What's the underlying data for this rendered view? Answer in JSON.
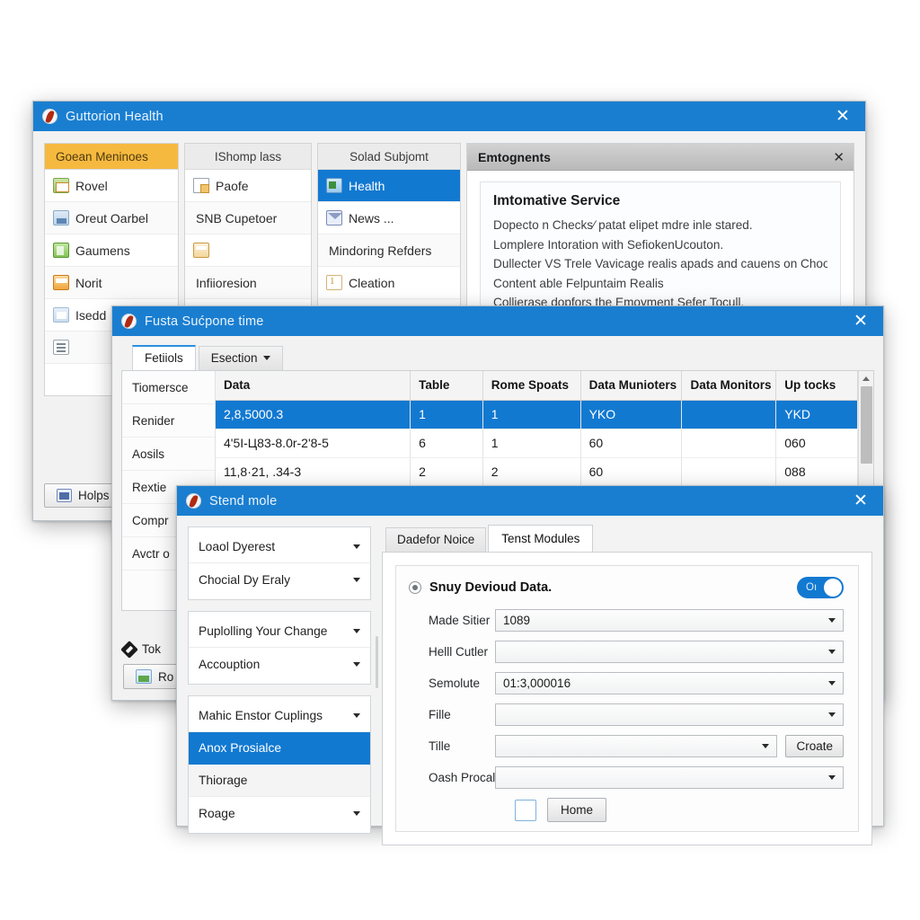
{
  "window1": {
    "title": "Guttorion Health",
    "close_label": "✕",
    "columns": [
      {
        "header": "Goean Meninoes",
        "items": [
          {
            "label": "Rovel",
            "icon": "document-green-icon"
          },
          {
            "label": "Oreut Oarbel",
            "icon": "chart-blue-icon"
          },
          {
            "label": "Gaumens",
            "icon": "app-green-icon"
          },
          {
            "label": "Norit",
            "icon": "card-orange-icon"
          },
          {
            "label": "Isedd",
            "icon": "pale-blue-icon"
          },
          {
            "label": "",
            "icon": "document-icon"
          }
        ]
      },
      {
        "header": "IShomp lass",
        "items": [
          {
            "label": "Paofe",
            "icon": "page-icon"
          },
          {
            "label": "SNB Cupetoer",
            "icon": ""
          },
          {
            "label": "",
            "icon": "card-icon"
          },
          {
            "label": "Infiioresion",
            "icon": ""
          },
          {
            "label": "",
            "icon": ""
          }
        ]
      },
      {
        "header": "Solad Subjomt",
        "items": [
          {
            "label": "Health",
            "icon": "health-icon",
            "selected": true
          },
          {
            "label": "News ...",
            "icon": "mail-icon"
          },
          {
            "label": "Mindoring Refders",
            "icon": ""
          },
          {
            "label": "Cleation",
            "icon": "number-icon"
          },
          {
            "label": "",
            "icon": "mail2-icon"
          }
        ]
      }
    ],
    "detail": {
      "title": "Emtognents",
      "close_label": "✕",
      "heading": "Imtomative Service",
      "lines": [
        "Dopecto n Checks⁄ patat elipet mdre inle stared.",
        "Lomplere Intoration with SefiokenUcouton.",
        "Dullecter VS Trele Vavicage realis apads and cauens on Choolt.",
        "Content able Felpuntaim Realis",
        "Collierase dopfors the Emoyment Sefer Tocull."
      ]
    },
    "footer": {
      "help_label": "Holps",
      "help_icon": "help-icon"
    }
  },
  "window2": {
    "title": "Fusta Sućpone time",
    "close_label": "✕",
    "tabs": [
      {
        "label": "Fetiiols",
        "active": true
      },
      {
        "label": "Esection",
        "dropdown": true
      }
    ],
    "side_items": [
      "Tiomersce",
      "Renider",
      "Aosils",
      "Rextie",
      "Compr",
      "Avctr o"
    ],
    "table": {
      "headers": [
        "Data",
        "Table",
        "Rome Spoats",
        "Data Munioters",
        "Data Monitors",
        "Up tocks"
      ],
      "rows": [
        {
          "cells": [
            "2,8,5000.3",
            "1",
            "1",
            "YKO",
            "",
            "YKD"
          ],
          "selected": true
        },
        {
          "cells": [
            "4'5I-Ц83-8.0r-2'8-5",
            "6",
            "1",
            "60",
            "",
            "060"
          ],
          "selected": false
        },
        {
          "cells": [
            "11,8·21, .34-3",
            "2",
            "2",
            "60",
            "",
            "088"
          ],
          "selected": false
        }
      ]
    },
    "footer": {
      "tok_label": "Tok",
      "ro_label": "Ro",
      "tok_icon": "diamond-icon",
      "ro_icon": "folder-icon"
    }
  },
  "window3": {
    "title": "Stend mole",
    "close_label": "✕",
    "left_groups": [
      {
        "rows": [
          {
            "label": "Loaol Dyerest",
            "type": "dropdown"
          },
          {
            "label": "Chocial Dy Eraly",
            "type": "dropdown"
          }
        ]
      },
      {
        "rows": [
          {
            "label": "Puplolling Your Change",
            "type": "dropdown"
          },
          {
            "label": "Accouption",
            "type": "dropdown"
          }
        ]
      },
      {
        "rows": [
          {
            "label": "Mahic Enstor Cuplings",
            "type": "dropdown"
          },
          {
            "label": "Anox Prosialce",
            "type": "item",
            "selected": true
          },
          {
            "label": "Thiorage",
            "type": "item",
            "highlight": true
          },
          {
            "label": "Roage",
            "type": "dropdown"
          }
        ]
      }
    ],
    "tabs": [
      {
        "label": "Dadefor Noice",
        "active": false
      },
      {
        "label": "Tenst Modules",
        "active": true
      }
    ],
    "form": {
      "heading": "Snuy Devioud Data.",
      "toggle_label": "Oı",
      "toggle_on": true,
      "fields": [
        {
          "label": "Made Sitier",
          "value": "1089"
        },
        {
          "label": "Helll Cutler",
          "value": ""
        },
        {
          "label": "Semolute",
          "value": "01:3,000016"
        },
        {
          "label": "Fille",
          "value": ""
        },
        {
          "label": "Tille",
          "value": "",
          "button": "Croate"
        },
        {
          "label": "Oash Procals",
          "value": ""
        }
      ],
      "home_button": "Home"
    }
  }
}
